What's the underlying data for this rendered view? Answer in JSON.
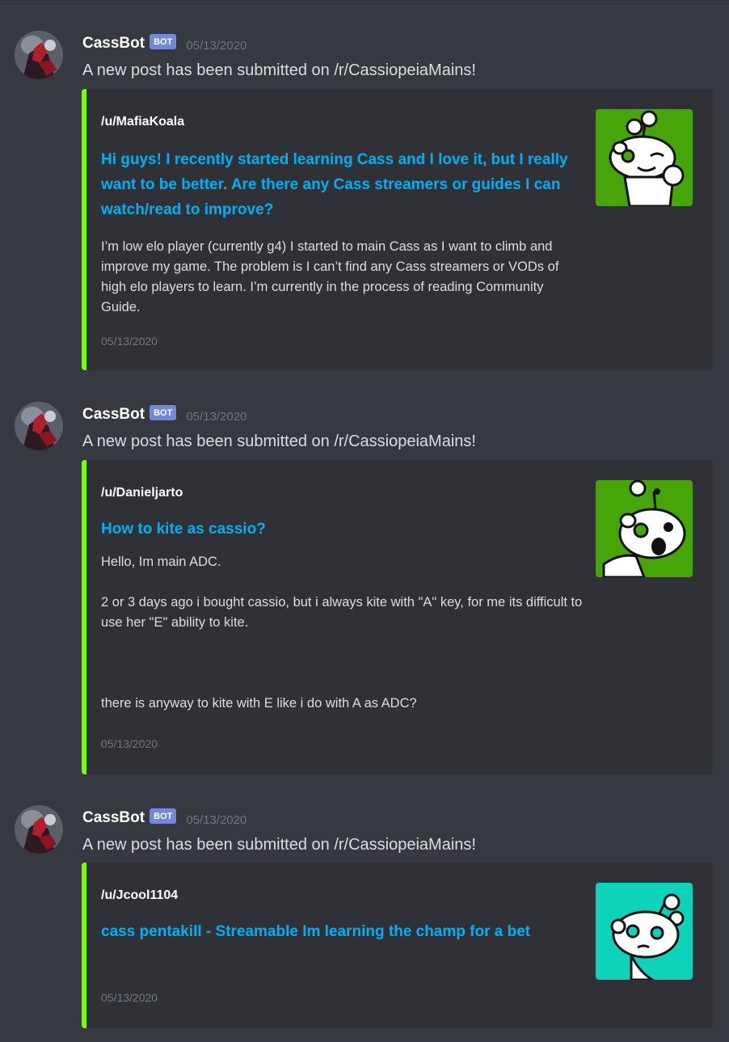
{
  "messages": [
    {
      "username": "CassBot",
      "bot_tag": "BOT",
      "timestamp": "05/13/2020",
      "content": "A new post has been submitted on /r/CassiopeiaMains!",
      "embed": {
        "author": "/u/MafiaKoala",
        "title": "Hi guys! I recently started learning Cass and I love it, but I really want to be better. Are there any Cass streamers or guides I can watch/read to improve?",
        "description": "I’m low elo player (currently g4) I started to main Cass as I want to climb and improve my game. The problem is I can’t find any Cass streamers or VODs of high elo players to learn. I’m currently in the process of reading Community Guide.",
        "footer": "05/13/2020",
        "thumbnail_icon": "reddit-snoo-wink-icon",
        "thumbnail_color": "#46a508"
      }
    },
    {
      "username": "CassBot",
      "bot_tag": "BOT",
      "timestamp": "05/13/2020",
      "content": "A new post has been submitted on /r/CassiopeiaMains!",
      "embed": {
        "author": "/u/Danieljarto",
        "title": "How to kite as cassio?",
        "description": "Hello, Im main ADC.\n\n2 or 3 days ago i bought cassio, but i always kite with \"A\" key, for me its difficult to use her \"E\" ability to kite.\n\n\n\nthere is anyway to kite with E like i do with A as ADC?",
        "footer": "05/13/2020",
        "thumbnail_icon": "reddit-snoo-surprised-icon",
        "thumbnail_color": "#46a508"
      }
    },
    {
      "username": "CassBot",
      "bot_tag": "BOT",
      "timestamp": "05/13/2020",
      "content": "A new post has been submitted on /r/CassiopeiaMains!",
      "embed": {
        "author": "/u/Jcool1104",
        "title": "cass pentakill - Streamable Im learning the champ for a bet",
        "description": "",
        "footer": "05/13/2020",
        "thumbnail_icon": "reddit-snoo-thinking-icon",
        "thumbnail_color": "#0dd3bb"
      }
    }
  ],
  "colors": {
    "background": "#36393f",
    "embed_background": "#2f3136",
    "embed_accent": "#7cfc00",
    "link": "#00b0f4",
    "bot_tag": "#7289da"
  }
}
